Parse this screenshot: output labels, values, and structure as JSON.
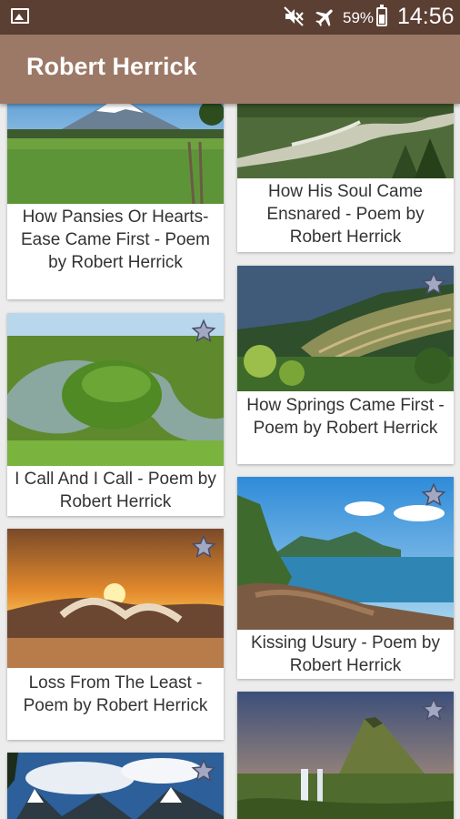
{
  "status_bar": {
    "battery_text": "59%",
    "time": "14:56"
  },
  "app_bar": {
    "title": "Robert Herrick"
  },
  "poems": [
    {
      "title": "How Pansies Or Hearts-Ease Came First - Poem by Robert Herrick",
      "image": "mountain-meadow-image"
    },
    {
      "title": "How His Soul Came Ensnared - Poem by Robert Herrick",
      "image": "river-valley-image"
    },
    {
      "title": "I Call And I Call - Poem by Robert Herrick",
      "image": "river-bend-image"
    },
    {
      "title": "How Springs Came First - Poem by Robert Herrick",
      "image": "terraced-hills-image"
    },
    {
      "title": "Loss From The Least - Poem by Robert Herrick",
      "image": "sunset-waves-image"
    },
    {
      "title": "Kissing Usury - Poem by Robert Herrick",
      "image": "rocky-coast-image"
    },
    {
      "title": "",
      "image": "snowy-mountains-image"
    },
    {
      "title": "",
      "image": "waterfall-mountain-image"
    }
  ]
}
